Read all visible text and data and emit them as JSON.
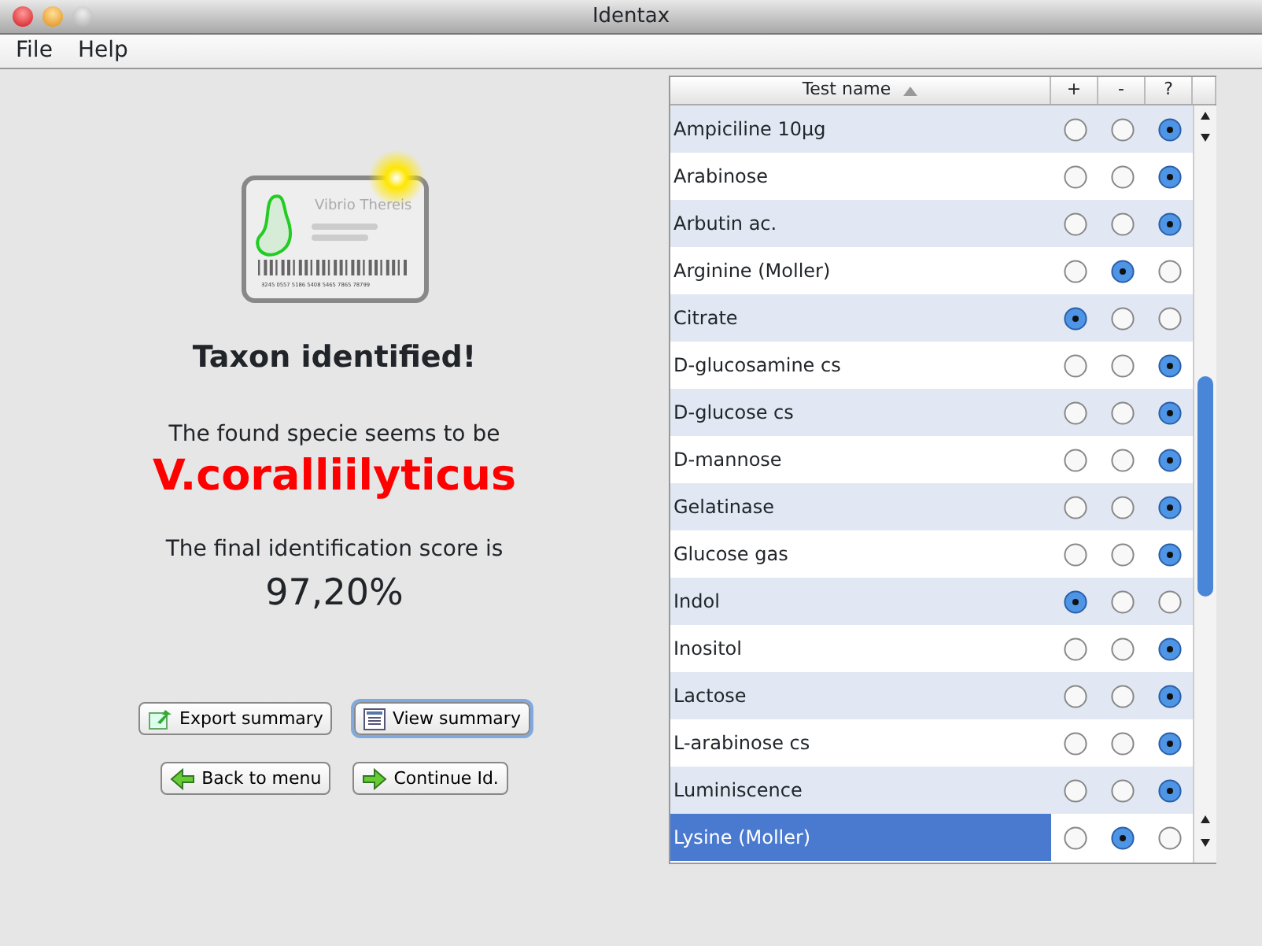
{
  "window": {
    "title": "Identax"
  },
  "menu": [
    "File",
    "Help"
  ],
  "card_icon": {
    "label": "Vibrio Thereis",
    "barcode": "3245 0557 5186 5408 5465 7865 78799"
  },
  "result": {
    "heading": "Taxon identified!",
    "intro": "The found specie seems to be",
    "species": "V.coralliilyticus",
    "score_label": "The final identification score is",
    "score": "97,20%"
  },
  "buttons": [
    {
      "label": "Export summary",
      "kind": "export",
      "focused": false
    },
    {
      "label": "View summary",
      "kind": "list",
      "focused": true
    },
    {
      "label": "Back to menu",
      "kind": "back",
      "focused": false
    },
    {
      "label": "Continue Id.",
      "kind": "forward",
      "focused": false
    }
  ],
  "table": {
    "columns": [
      "Test name",
      "+",
      "-",
      "?"
    ],
    "rows": [
      {
        "name": "Ampiciline 10µg",
        "selected": false,
        "answers": [
          {
            "selected": false
          },
          {
            "selected": false
          },
          {
            "selected": true
          }
        ]
      },
      {
        "name": "Arabinose",
        "selected": false,
        "answers": [
          {
            "selected": false
          },
          {
            "selected": false
          },
          {
            "selected": true
          }
        ]
      },
      {
        "name": "Arbutin ac.",
        "selected": false,
        "answers": [
          {
            "selected": false
          },
          {
            "selected": false
          },
          {
            "selected": true
          }
        ]
      },
      {
        "name": "Arginine (Moller)",
        "selected": false,
        "answers": [
          {
            "selected": false
          },
          {
            "selected": true
          },
          {
            "selected": false
          }
        ]
      },
      {
        "name": "Citrate",
        "selected": false,
        "answers": [
          {
            "selected": true
          },
          {
            "selected": false
          },
          {
            "selected": false
          }
        ]
      },
      {
        "name": "D-glucosamine cs",
        "selected": false,
        "answers": [
          {
            "selected": false
          },
          {
            "selected": false
          },
          {
            "selected": true
          }
        ]
      },
      {
        "name": "D-glucose cs",
        "selected": false,
        "answers": [
          {
            "selected": false
          },
          {
            "selected": false
          },
          {
            "selected": true
          }
        ]
      },
      {
        "name": "D-mannose",
        "selected": false,
        "answers": [
          {
            "selected": false
          },
          {
            "selected": false
          },
          {
            "selected": true
          }
        ]
      },
      {
        "name": "Gelatinase",
        "selected": false,
        "answers": [
          {
            "selected": false
          },
          {
            "selected": false
          },
          {
            "selected": true
          }
        ]
      },
      {
        "name": "Glucose gas",
        "selected": false,
        "answers": [
          {
            "selected": false
          },
          {
            "selected": false
          },
          {
            "selected": true
          }
        ]
      },
      {
        "name": "Indol",
        "selected": false,
        "answers": [
          {
            "selected": true
          },
          {
            "selected": false
          },
          {
            "selected": false
          }
        ]
      },
      {
        "name": "Inositol",
        "selected": false,
        "answers": [
          {
            "selected": false
          },
          {
            "selected": false
          },
          {
            "selected": true
          }
        ]
      },
      {
        "name": "Lactose",
        "selected": false,
        "answers": [
          {
            "selected": false
          },
          {
            "selected": false
          },
          {
            "selected": true
          }
        ]
      },
      {
        "name": "L-arabinose cs",
        "selected": false,
        "answers": [
          {
            "selected": false
          },
          {
            "selected": false
          },
          {
            "selected": true
          }
        ]
      },
      {
        "name": "Luminiscence",
        "selected": false,
        "answers": [
          {
            "selected": false
          },
          {
            "selected": false
          },
          {
            "selected": true
          }
        ]
      },
      {
        "name": "Lysine (Moller)",
        "selected": true,
        "answers": [
          {
            "selected": false
          },
          {
            "selected": true
          },
          {
            "selected": false
          }
        ]
      }
    ]
  }
}
